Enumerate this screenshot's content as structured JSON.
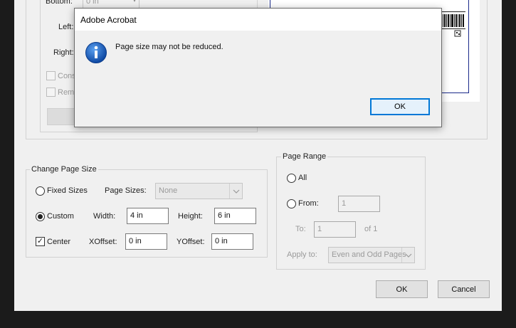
{
  "margins": {
    "bottom_label": "Bottom:",
    "bottom_value": "0 in",
    "left_label": "Left:",
    "right_label": "Right:",
    "constrain_label": "Cons",
    "remove_label": "Rem"
  },
  "change_page_size": {
    "title": "Change Page Size",
    "fixed_sizes_label": "Fixed Sizes",
    "page_sizes_label": "Page Sizes:",
    "page_sizes_value": "None",
    "custom_label": "Custom",
    "width_label": "Width:",
    "width_value": "4 in",
    "height_label": "Height:",
    "height_value": "6 in",
    "center_label": "Center",
    "xoffset_label": "XOffset:",
    "xoffset_value": "0 in",
    "yoffset_label": "YOffset:",
    "yoffset_value": "0 in"
  },
  "page_range": {
    "title": "Page Range",
    "all_label": "All",
    "from_label": "From:",
    "from_value": "1",
    "to_label": "To:",
    "to_value": "1",
    "of_label": "of 1",
    "apply_to_label": "Apply to:",
    "apply_to_value": "Even and Odd Pages"
  },
  "buttons": {
    "ok": "OK",
    "cancel": "Cancel"
  },
  "alert": {
    "title": "Adobe Acrobat",
    "message": "Page size may not be reduced.",
    "ok": "OK"
  },
  "colors": {
    "accent": "#0078d7",
    "icon_blue": "#1565c0",
    "page_border": "#1a2a8a"
  }
}
